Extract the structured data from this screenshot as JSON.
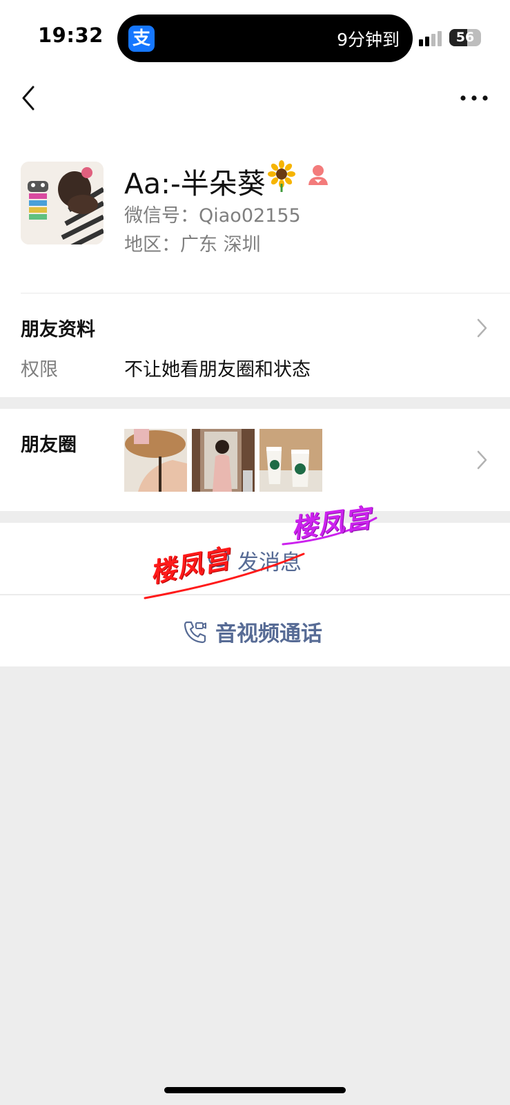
{
  "status_bar": {
    "time": "19:32",
    "island_app_icon": "alipay-icon",
    "island_app_glyph": "支",
    "island_text": "9分钟到",
    "battery_level": "56",
    "battery_fraction": 0.56
  },
  "nav": {
    "back_icon": "chevron-left-icon",
    "more_icon": "more-dots-icon"
  },
  "profile": {
    "nickname": "Aa:-半朵葵",
    "nickname_emoji": "sunflower-icon",
    "gender_icon": "female-icon",
    "wechat_id": "微信号：Qiao02155",
    "region": "地区：广东 深圳"
  },
  "friend_info": {
    "title": "朋友资料",
    "permission_label": "权限",
    "permission_value": "不让她看朋友圈和状态"
  },
  "moments": {
    "title": "朋友圈",
    "thumbnails": [
      "thumbnail-legs-cafe-table",
      "thumbnail-mirror-selfie",
      "thumbnail-starbucks-cups"
    ]
  },
  "actions": {
    "send_message": "发消息",
    "av_call": "音视频通话"
  },
  "watermarks": {
    "red": "楼凤宫",
    "magenta": "楼凤宫"
  },
  "colors": {
    "link_blue": "#576b95",
    "page_bg": "#ededed",
    "alipay_blue": "#1677ff",
    "female_pink": "#f37b7b"
  }
}
